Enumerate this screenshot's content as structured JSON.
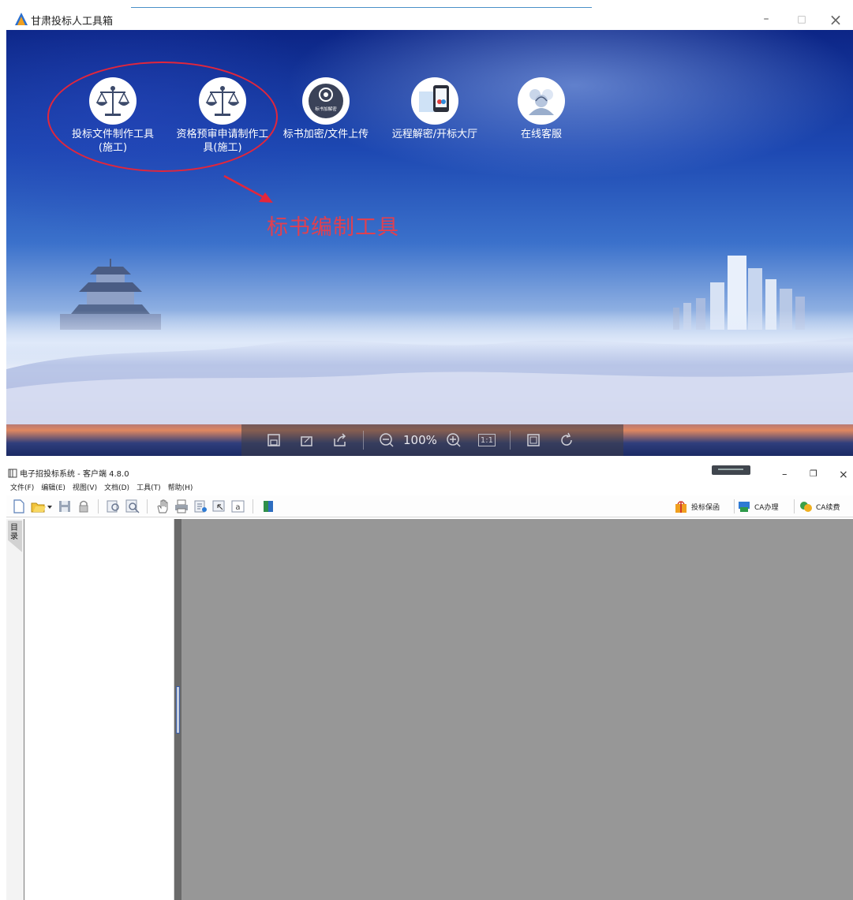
{
  "toolbox": {
    "title": "甘肃投标人工具箱",
    "controls": {
      "minimize": "–",
      "maximize": "□",
      "close": "×"
    },
    "tools": [
      {
        "label": "投标文件制作工具\n(施工)",
        "icon": "scales-icon"
      },
      {
        "label": "资格预审申请制作工\n具(施工)",
        "icon": "scales-icon"
      },
      {
        "label": "标书加密/文件上传",
        "icon": "encrypt-badge-icon",
        "badge_text": "标书加解密"
      },
      {
        "label": "远程解密/开标大厅",
        "icon": "tablet-icon"
      },
      {
        "label": "在线客服",
        "icon": "customer-service-icon"
      }
    ],
    "annotation": {
      "text": "标书编制工具",
      "color": "#e04050"
    },
    "viewer_bar": {
      "zoom": "100%",
      "one_to_one": "1:1"
    }
  },
  "client": {
    "title": "电子招投标系统 - 客户端 4.8.0",
    "menu": [
      "文件(F)",
      "编辑(E)",
      "视图(V)",
      "文档(D)",
      "工具(T)",
      "帮助(H)"
    ],
    "controls": {
      "minimize": "–",
      "restore": "❐",
      "close": "×"
    },
    "right_buttons": [
      {
        "label": "投标保函",
        "icon": "gift-bag-icon"
      },
      {
        "label": "CA办理",
        "icon": "ca-card-icon"
      },
      {
        "label": "CA续费",
        "icon": "ca-renew-icon"
      }
    ],
    "sidebar_tab": "目录"
  },
  "colors": {
    "accent_red": "#e3263b",
    "doc_background": "#979797",
    "banner_top": "#0c2586"
  }
}
